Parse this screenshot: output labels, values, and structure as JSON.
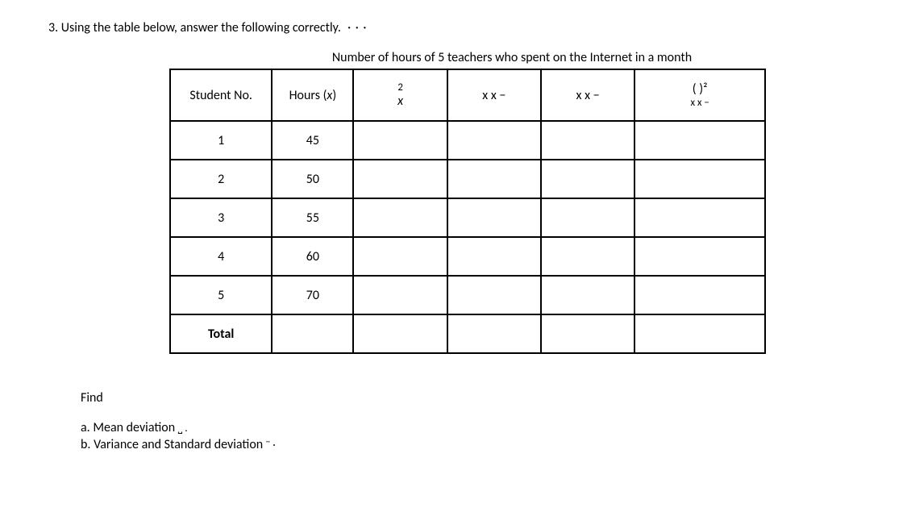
{
  "question": {
    "number": "3.",
    "text": "Using the table below, answer the following correctly."
  },
  "table": {
    "caption": "Number of hours of 5 teachers who spent on the Internet in a month",
    "headers": {
      "col1": "Student No.",
      "col2_pre": "Hours (",
      "col2_var": "x",
      "col2_post": ")",
      "col3_top": "2",
      "col3_bot": "x",
      "col4": "x x −",
      "col5": "x x −",
      "col6_top": "( )²",
      "col6_bot": "x x −"
    },
    "rows": [
      {
        "no": "1",
        "hours": "45",
        "c3": "",
        "c4": "",
        "c5": "",
        "c6": ""
      },
      {
        "no": "2",
        "hours": "50",
        "c3": "",
        "c4": "",
        "c5": "",
        "c6": ""
      },
      {
        "no": "3",
        "hours": "55",
        "c3": "",
        "c4": "",
        "c5": "",
        "c6": ""
      },
      {
        "no": "4",
        "hours": "60",
        "c3": "",
        "c4": "",
        "c5": "",
        "c6": ""
      },
      {
        "no": "5",
        "hours": "70",
        "c3": "",
        "c4": "",
        "c5": "",
        "c6": ""
      }
    ],
    "total_label": "Total"
  },
  "find": {
    "label": "Find",
    "a": "a. Mean deviation",
    "b": "b. Variance and Standard deviation"
  },
  "chart_data": {
    "type": "table",
    "title": "Number of hours of 5 teachers who spent on the Internet in a month",
    "columns": [
      "Student No.",
      "Hours (x)",
      "x²",
      "x x −",
      "x x −",
      "( )² x x −"
    ],
    "data": [
      [
        1,
        45,
        null,
        null,
        null,
        null
      ],
      [
        2,
        50,
        null,
        null,
        null,
        null
      ],
      [
        3,
        55,
        null,
        null,
        null,
        null
      ],
      [
        4,
        60,
        null,
        null,
        null,
        null
      ],
      [
        5,
        70,
        null,
        null,
        null,
        null
      ]
    ],
    "total_row": [
      "Total",
      null,
      null,
      null,
      null,
      null
    ]
  }
}
